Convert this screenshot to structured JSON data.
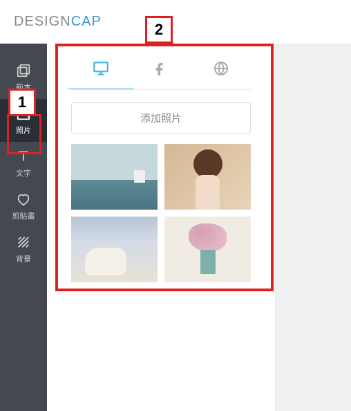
{
  "logo": {
    "part1": "DESIGN",
    "part2": "CAP"
  },
  "sidebar": {
    "items": [
      {
        "label": "範本"
      },
      {
        "label": "照片"
      },
      {
        "label": "文字"
      },
      {
        "label": "剪貼畫"
      },
      {
        "label": "背景"
      }
    ]
  },
  "panel": {
    "add_photo_label": "添加照片"
  },
  "callouts": {
    "one": "1",
    "two": "2"
  }
}
